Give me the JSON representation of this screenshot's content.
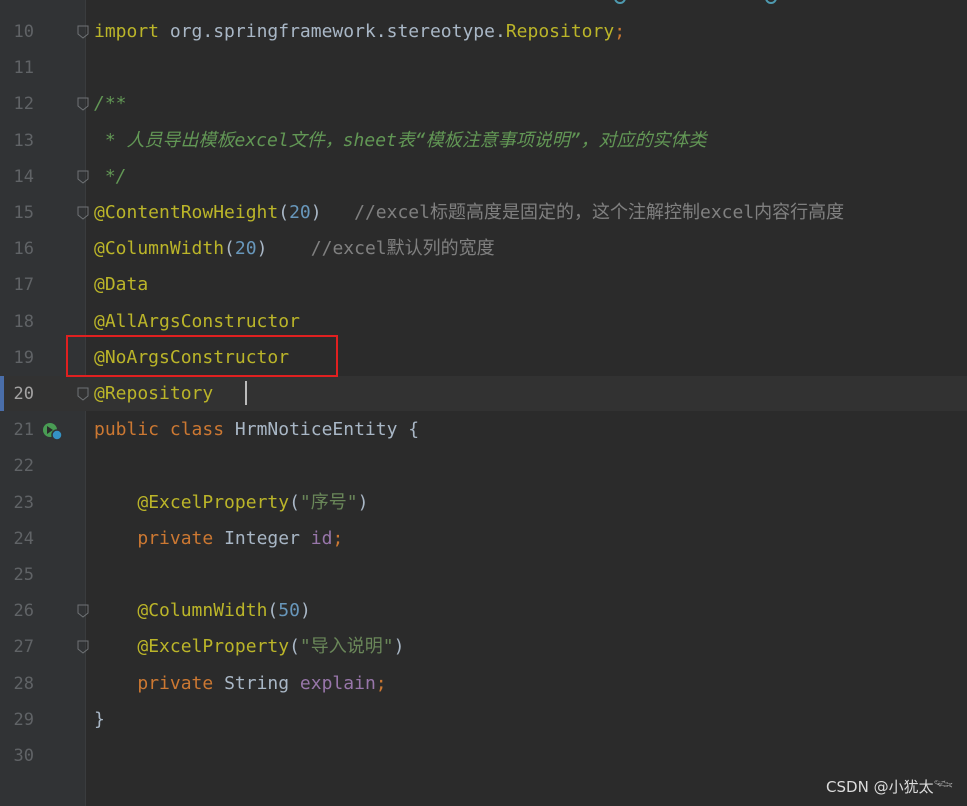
{
  "editor": {
    "current_line": "20",
    "lines": [
      {
        "num": "10",
        "tokens": [
          {
            "t": "import",
            "c": "ann"
          },
          {
            "t": " org.springframework.stereotype.",
            "c": "punc"
          },
          {
            "t": "Repository",
            "c": "ann"
          },
          {
            "t": ";",
            "c": "kw"
          }
        ]
      },
      {
        "num": "11",
        "tokens": []
      },
      {
        "num": "12",
        "tokens": [
          {
            "t": "/**",
            "c": "doc"
          }
        ]
      },
      {
        "num": "13",
        "tokens": [
          {
            "t": " * 人员导出模板excel文件，sheet表“模板注意事项说明”，对应的实体类",
            "c": "doc"
          }
        ]
      },
      {
        "num": "14",
        "tokens": [
          {
            "t": " */",
            "c": "doc"
          }
        ]
      },
      {
        "num": "15",
        "tokens": [
          {
            "t": "@ContentRowHeight",
            "c": "ann"
          },
          {
            "t": "(",
            "c": "punc"
          },
          {
            "t": "20",
            "c": "num"
          },
          {
            "t": ")   ",
            "c": "punc"
          },
          {
            "t": "//excel标题高度是固定的，这个注解控制excel内容行高度",
            "c": "cmt"
          }
        ]
      },
      {
        "num": "16",
        "tokens": [
          {
            "t": "@ColumnWidth",
            "c": "ann"
          },
          {
            "t": "(",
            "c": "punc"
          },
          {
            "t": "20",
            "c": "num"
          },
          {
            "t": ")    ",
            "c": "punc"
          },
          {
            "t": "//excel默认列的宽度",
            "c": "cmt"
          }
        ]
      },
      {
        "num": "17",
        "tokens": [
          {
            "t": "@Data",
            "c": "ann"
          }
        ]
      },
      {
        "num": "18",
        "tokens": [
          {
            "t": "@AllArgsConstructor",
            "c": "ann"
          }
        ]
      },
      {
        "num": "19",
        "tokens": [
          {
            "t": "@NoArgsConstructor",
            "c": "ann"
          }
        ]
      },
      {
        "num": "20",
        "tokens": [
          {
            "t": "@Repository",
            "c": "ann"
          }
        ]
      },
      {
        "num": "21",
        "tokens": [
          {
            "t": "public class ",
            "c": "kw"
          },
          {
            "t": "HrmNoticeEntity {",
            "c": "punc"
          }
        ]
      },
      {
        "num": "22",
        "tokens": []
      },
      {
        "num": "23",
        "tokens": [
          {
            "t": "    ",
            "c": "punc"
          },
          {
            "t": "@ExcelProperty",
            "c": "ann"
          },
          {
            "t": "(",
            "c": "punc"
          },
          {
            "t": "\"序号\"",
            "c": "str"
          },
          {
            "t": ")",
            "c": "punc"
          }
        ]
      },
      {
        "num": "24",
        "tokens": [
          {
            "t": "    ",
            "c": "punc"
          },
          {
            "t": "private ",
            "c": "kw"
          },
          {
            "t": "Integer ",
            "c": "punc"
          },
          {
            "t": "id",
            "c": "fld"
          },
          {
            "t": ";",
            "c": "kw"
          }
        ]
      },
      {
        "num": "25",
        "tokens": []
      },
      {
        "num": "26",
        "tokens": [
          {
            "t": "    ",
            "c": "punc"
          },
          {
            "t": "@ColumnWidth",
            "c": "ann"
          },
          {
            "t": "(",
            "c": "punc"
          },
          {
            "t": "50",
            "c": "num"
          },
          {
            "t": ")",
            "c": "punc"
          }
        ]
      },
      {
        "num": "27",
        "tokens": [
          {
            "t": "    ",
            "c": "punc"
          },
          {
            "t": "@ExcelProperty",
            "c": "ann"
          },
          {
            "t": "(",
            "c": "punc"
          },
          {
            "t": "\"导入说明\"",
            "c": "str"
          },
          {
            "t": ")",
            "c": "punc"
          }
        ]
      },
      {
        "num": "28",
        "tokens": [
          {
            "t": "    ",
            "c": "punc"
          },
          {
            "t": "private ",
            "c": "kw"
          },
          {
            "t": "String ",
            "c": "punc"
          },
          {
            "t": "explain",
            "c": "fld"
          },
          {
            "t": ";",
            "c": "kw"
          }
        ]
      },
      {
        "num": "29",
        "tokens": [
          {
            "t": "}",
            "c": "punc"
          }
        ]
      },
      {
        "num": "30",
        "tokens": []
      }
    ],
    "fold_markers": [
      "10",
      "12",
      "14",
      "15",
      "20",
      "26",
      "27"
    ]
  },
  "gutter_icon": "run-class-icon",
  "highlight": {
    "line": "19",
    "color": "#e02020"
  },
  "watermark": {
    "text": "CSDN @小犹太𓆝"
  },
  "colors": {
    "background": "#2b2b2b",
    "gutter": "#313335",
    "keyword": "#cc7832",
    "annotation": "#bbb529",
    "number": "#6897bb",
    "string": "#6a8759",
    "comment": "#808080",
    "doc_comment": "#629755",
    "field": "#9876aa"
  }
}
